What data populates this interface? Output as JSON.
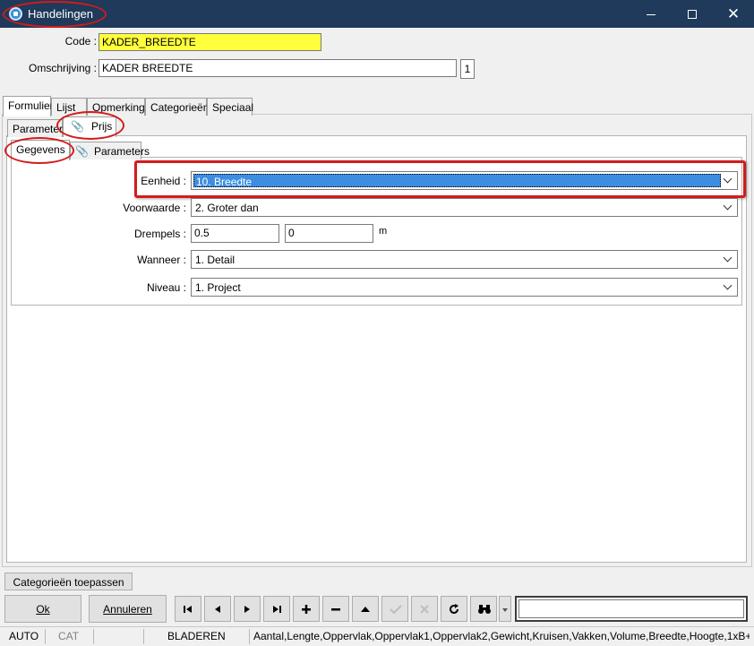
{
  "window": {
    "title": "Handelingen"
  },
  "form": {
    "code_label": "Code :",
    "code_value": "KADER_BREEDTE",
    "omschrijving_label": "Omschrijving :",
    "omschrijving_value": "KADER BREEDTE",
    "counter": "1"
  },
  "main_tabs": [
    "Formulier",
    "Lijst",
    "Opmerking",
    "Categorieën",
    "Speciaal"
  ],
  "sub_tabs": [
    "Parameters",
    "Prijs"
  ],
  "inner_tabs": [
    "Gegevens",
    "Parameters"
  ],
  "fields": {
    "eenheid_label": "Eenheid :",
    "eenheid_value": "10. Breedte",
    "voorwaarde_label": "Voorwaarde :",
    "voorwaarde_value": "2.  Groter dan",
    "drempels_label": "Drempels :",
    "drempels_value1": "0.5",
    "drempels_value2": "0",
    "drempels_unit": "m",
    "wanneer_label": "Wanneer :",
    "wanneer_value": "1.  Detail",
    "niveau_label": "Niveau :",
    "niveau_value": "1.  Project"
  },
  "buttons": {
    "categorieen_toepassen": "Categorieën toepassen",
    "ok": "Ok",
    "annuleren": "Annuleren"
  },
  "statusbar": {
    "auto": "AUTO",
    "cat": "CAT",
    "mode": "BLADEREN",
    "fields_list": "Aantal,Lengte,Oppervlak,Oppervlak1,Oppervlak2,Gewicht,Kruisen,Vakken,Volume,Breedte,Hoogte,1xB+"
  },
  "colors": {
    "titlebar": "#1f3a5a",
    "highlight": "#d21c1c",
    "code_field": "#ffff3c",
    "selection": "#3d8ee0"
  }
}
